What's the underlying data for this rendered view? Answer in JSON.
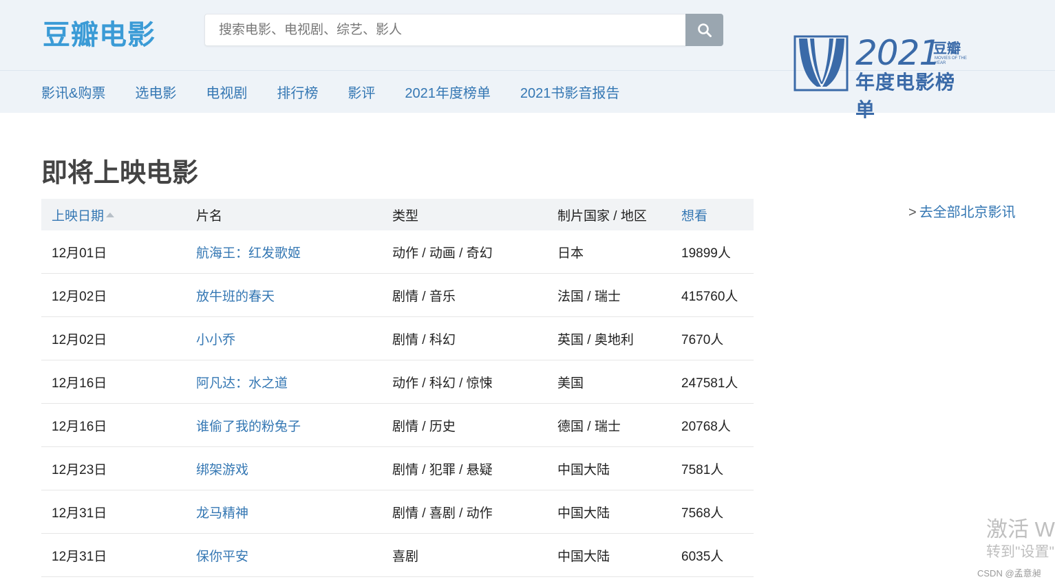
{
  "header": {
    "logo": "豆瓣电影",
    "search_placeholder": "搜索电影、电视剧、综艺、影人"
  },
  "nav": {
    "items": [
      "影讯&购票",
      "选电影",
      "电视剧",
      "排行榜",
      "影评",
      "2021年度榜单",
      "2021书影音报告"
    ]
  },
  "banner": {
    "year": "2021",
    "brand": "豆瓣",
    "small": "MOVIES OF THE YEAR",
    "title": "年度电影榜单"
  },
  "page_title": "即将上映电影",
  "table": {
    "headers": [
      "上映日期",
      "片名",
      "类型",
      "制片国家 / 地区",
      "想看"
    ],
    "rows": [
      {
        "date": "12月01日",
        "title": "航海王：红发歌姬",
        "genre": "动作 / 动画 / 奇幻",
        "region": "日本",
        "want": "19899人"
      },
      {
        "date": "12月02日",
        "title": "放牛班的春天",
        "genre": "剧情 / 音乐",
        "region": "法国 / 瑞士",
        "want": "415760人"
      },
      {
        "date": "12月02日",
        "title": "小小乔",
        "genre": "剧情 / 科幻",
        "region": "英国 / 奥地利",
        "want": "7670人"
      },
      {
        "date": "12月16日",
        "title": "阿凡达：水之道",
        "genre": "动作 / 科幻 / 惊悚",
        "region": "美国",
        "want": "247581人"
      },
      {
        "date": "12月16日",
        "title": "谁偷了我的粉兔子",
        "genre": "剧情 / 历史",
        "region": "德国 / 瑞士",
        "want": "20768人"
      },
      {
        "date": "12月23日",
        "title": "绑架游戏",
        "genre": "剧情 / 犯罪 / 悬疑",
        "region": "中国大陆",
        "want": "7581人"
      },
      {
        "date": "12月31日",
        "title": "龙马精神",
        "genre": "剧情 / 喜剧 / 动作",
        "region": "中国大陆",
        "want": "7568人"
      },
      {
        "date": "12月31日",
        "title": "保你平安",
        "genre": "喜剧",
        "region": "中国大陆",
        "want": "6035人"
      }
    ]
  },
  "side_link": {
    "arrow": ">",
    "label": "去全部北京影讯"
  },
  "watermark": {
    "line1": "激活 W",
    "line2": "转到\"设置\"",
    "csdn": "CSDN @孟意昶"
  }
}
